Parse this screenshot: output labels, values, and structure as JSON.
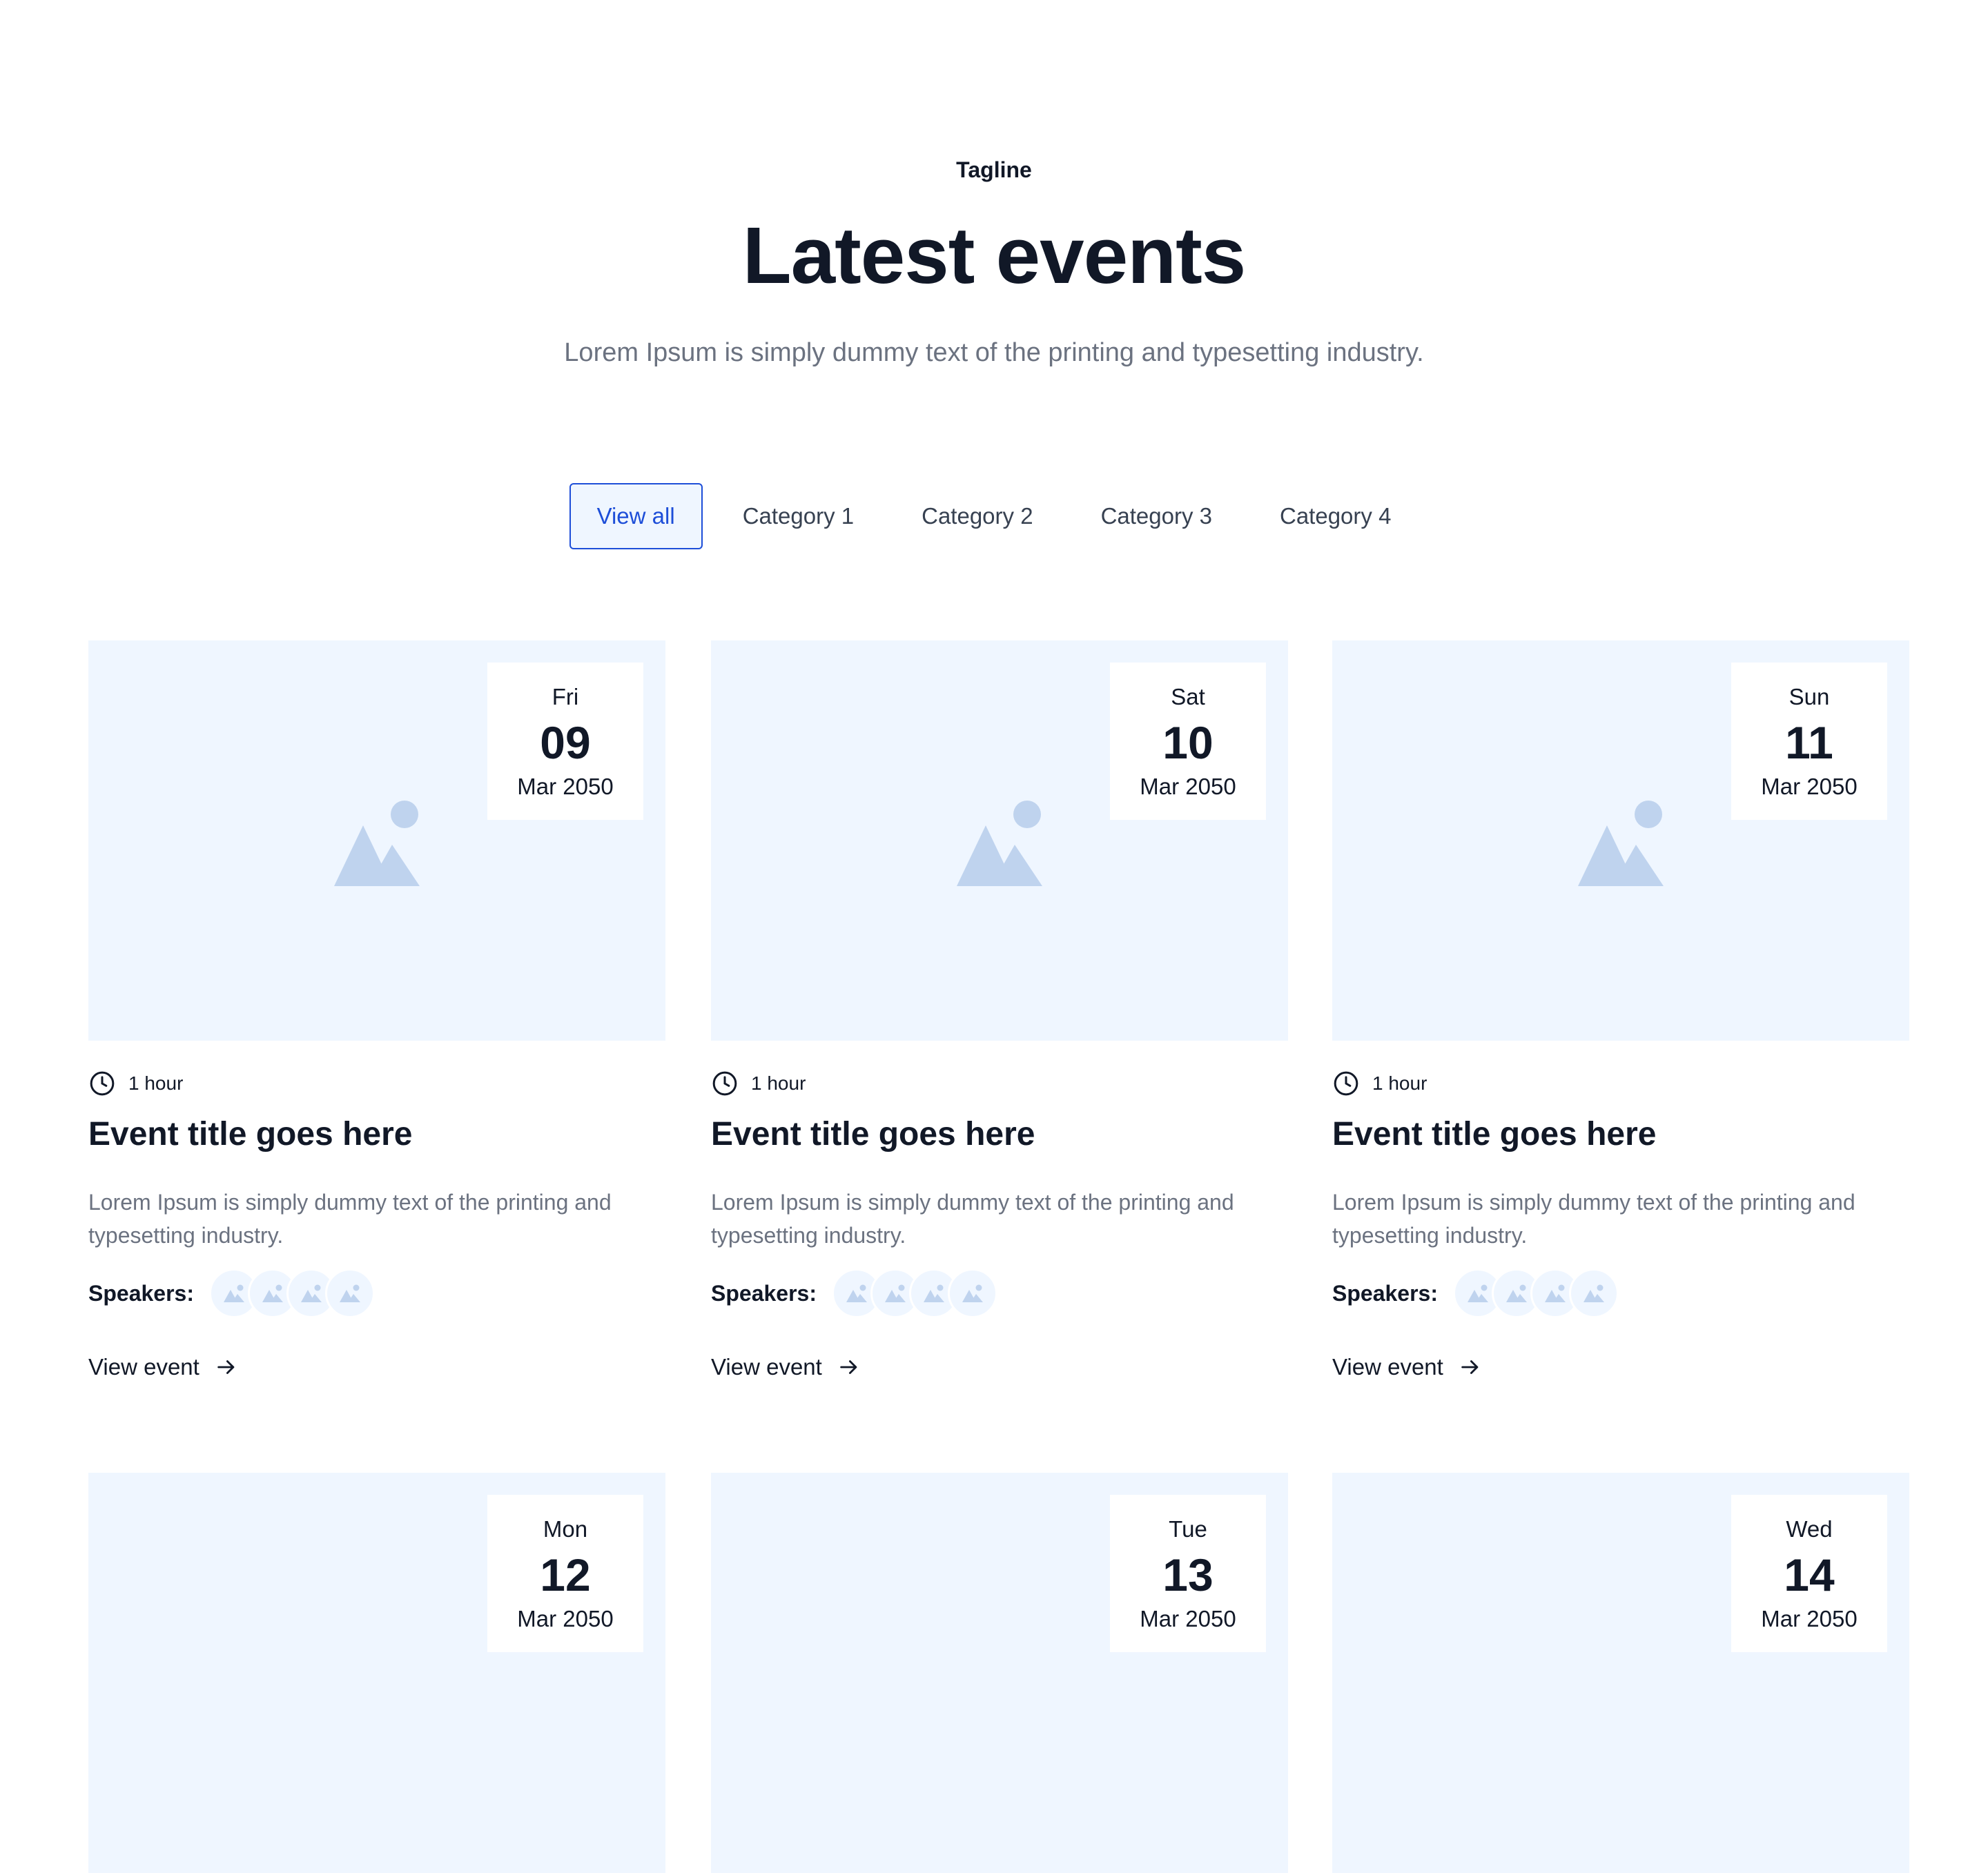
{
  "hero": {
    "tagline": "Tagline",
    "heading": "Latest events",
    "lead": "Lorem Ipsum is simply dummy text of the printing and typesetting industry."
  },
  "tabs": [
    {
      "label": "View all",
      "active": true
    },
    {
      "label": "Category 1",
      "active": false
    },
    {
      "label": "Category 2",
      "active": false
    },
    {
      "label": "Category 3",
      "active": false
    },
    {
      "label": "Category 4",
      "active": false
    }
  ],
  "events": [
    {
      "dow": "Fri",
      "day": "09",
      "month_year": "Mar 2050",
      "duration": "1 hour",
      "title": "Event title goes here",
      "description": "Lorem Ipsum is simply dummy text of the printing and typesetting industry.",
      "speakers_label": "Speakers:",
      "link_label": "View event"
    },
    {
      "dow": "Sat",
      "day": "10",
      "month_year": "Mar 2050",
      "duration": "1 hour",
      "title": "Event title goes here",
      "description": "Lorem Ipsum is simply dummy text of the printing and typesetting industry.",
      "speakers_label": "Speakers:",
      "link_label": "View event"
    },
    {
      "dow": "Sun",
      "day": "11",
      "month_year": "Mar 2050",
      "duration": "1 hour",
      "title": "Event title goes here",
      "description": "Lorem Ipsum is simply dummy text of the printing and typesetting industry.",
      "speakers_label": "Speakers:",
      "link_label": "View event"
    },
    {
      "dow": "Mon",
      "day": "12",
      "month_year": "Mar 2050"
    },
    {
      "dow": "Tue",
      "day": "13",
      "month_year": "Mar 2050"
    },
    {
      "dow": "Wed",
      "day": "14",
      "month_year": "Mar 2050"
    }
  ],
  "colors": {
    "accent": "#1d4ed8",
    "placeholder_bg": "#eff6ff",
    "placeholder_icon": "#bfd3ee",
    "heading": "#111827",
    "muted": "#6b7280"
  },
  "icons": {
    "duration": "clock-icon",
    "link": "arrow-right-icon",
    "media": "image-placeholder-icon",
    "avatar": "avatar-placeholder-icon"
  }
}
